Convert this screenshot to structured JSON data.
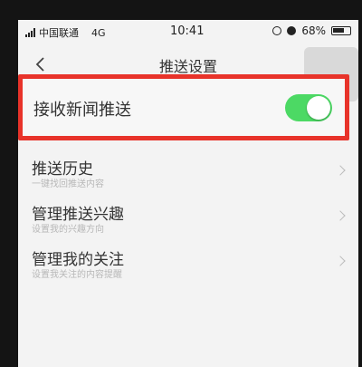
{
  "status_bar": {
    "carrier": "中国联通",
    "network": "4G",
    "time": "10:41",
    "battery": "68%"
  },
  "nav": {
    "title": "推送设置",
    "back_icon": "chevron-left-icon"
  },
  "push_setting": {
    "label": "接收新闻推送",
    "enabled": true,
    "toggle_color": "#4cd964",
    "highlight_color": "#e8332a"
  },
  "list": {
    "items": [
      {
        "title": "推送历史",
        "subtitle": "一键找回推送内容"
      },
      {
        "title": "管理推送兴趣",
        "subtitle": "设置我的兴趣方向"
      },
      {
        "title": "管理我的关注",
        "subtitle": "设置我关注的内容提醒"
      }
    ]
  }
}
